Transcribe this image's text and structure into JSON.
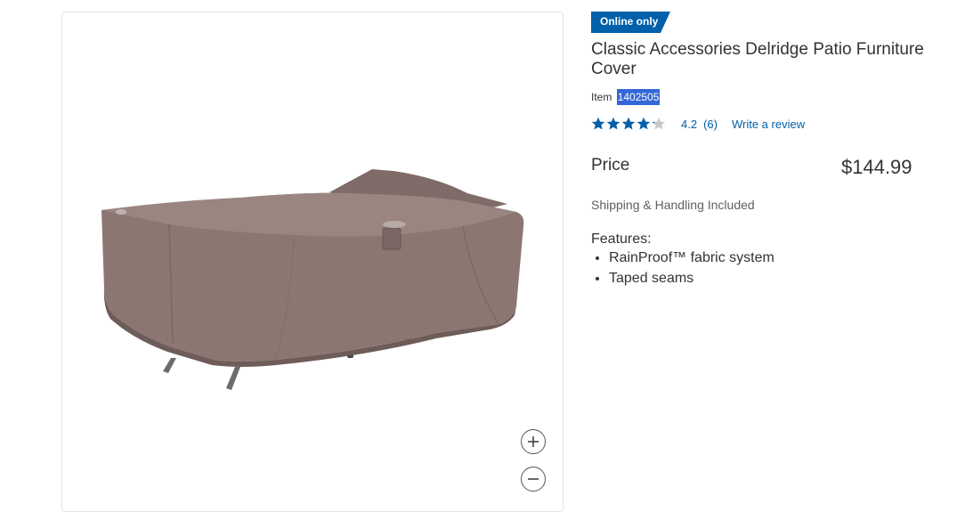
{
  "product": {
    "badge": "Online only",
    "title": "Classic Accessories Delridge Patio Furniture Cover",
    "item_label": "Item",
    "item_number": "1402505",
    "rating": "4.2",
    "rating_fraction": 0.84,
    "review_count": "(6)",
    "write_review": "Write a review",
    "price_label": "Price",
    "price": "$144.99",
    "shipping": "Shipping & Handling Included",
    "features_title": "Features:",
    "features": [
      "RainProof™ fabric system",
      "Taped seams"
    ]
  },
  "colors": {
    "badge": "#0060a9",
    "star": "#0060a9",
    "link": "#0060a9",
    "selection_highlight": "#3367d6",
    "cover_fabric": "#8b7672"
  },
  "icons": {
    "zoom_in": "zoom-in-icon",
    "zoom_out": "zoom-out-icon",
    "star": "star-icon"
  }
}
